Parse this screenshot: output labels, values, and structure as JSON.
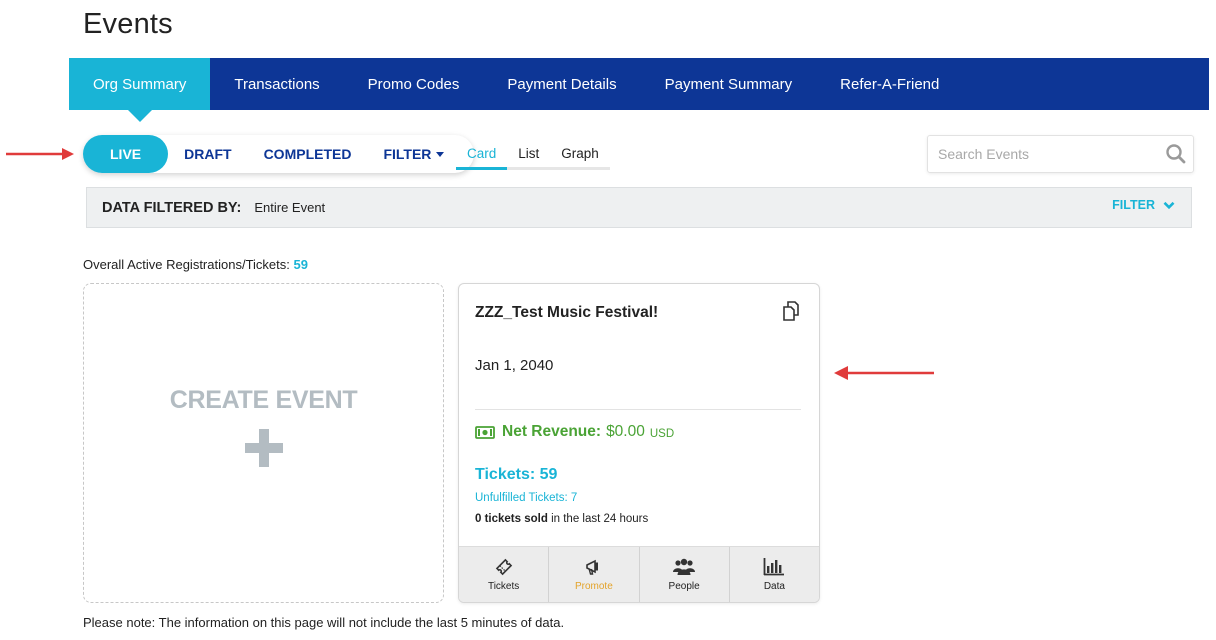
{
  "page": {
    "title": "Events"
  },
  "nav": {
    "tabs": [
      {
        "label": "Org Summary",
        "active": true
      },
      {
        "label": "Transactions"
      },
      {
        "label": "Promo Codes"
      },
      {
        "label": "Payment Details"
      },
      {
        "label": "Payment Summary"
      },
      {
        "label": "Refer-A-Friend"
      }
    ]
  },
  "status_tabs": {
    "live": "LIVE",
    "draft": "DRAFT",
    "completed": "COMPLETED",
    "filter": "FILTER",
    "active": "LIVE"
  },
  "view_tabs": {
    "card": "Card",
    "list": "List",
    "graph": "Graph",
    "active": "Card"
  },
  "search": {
    "placeholder": "Search Events",
    "value": ""
  },
  "filter_bar": {
    "label": "DATA FILTERED BY:",
    "value": "Entire Event",
    "toggle": "FILTER"
  },
  "overall": {
    "label": "Overall Active Registrations/Tickets:",
    "count": "59"
  },
  "create_event": {
    "label": "CREATE EVENT"
  },
  "event_card": {
    "name": "ZZZ_Test Music Festival!",
    "date": "Jan 1, 2040",
    "revenue_label": "Net Revenue:",
    "revenue_amount": "$0.00",
    "revenue_currency": "USD",
    "tickets_label": "Tickets: 59",
    "unfulfilled": "Unfulfilled Tickets: 7",
    "sold_bold": "0 tickets sold",
    "sold_rest": "in the last 24 hours",
    "actions": [
      {
        "label": "Tickets",
        "icon": "ticket-icon"
      },
      {
        "label": "Promote",
        "icon": "megaphone-icon"
      },
      {
        "label": "People",
        "icon": "people-icon"
      },
      {
        "label": "Data",
        "icon": "bar-chart-icon"
      }
    ]
  },
  "footer": {
    "note": "Please note: The information on this page will not include the last 5 minutes of data."
  },
  "colors": {
    "nav_bg": "#0d3696",
    "accent": "#19b4d6",
    "revenue_green": "#4aa335",
    "promote_orange": "#e3a32a",
    "annotation_red": "#e03b3b"
  }
}
